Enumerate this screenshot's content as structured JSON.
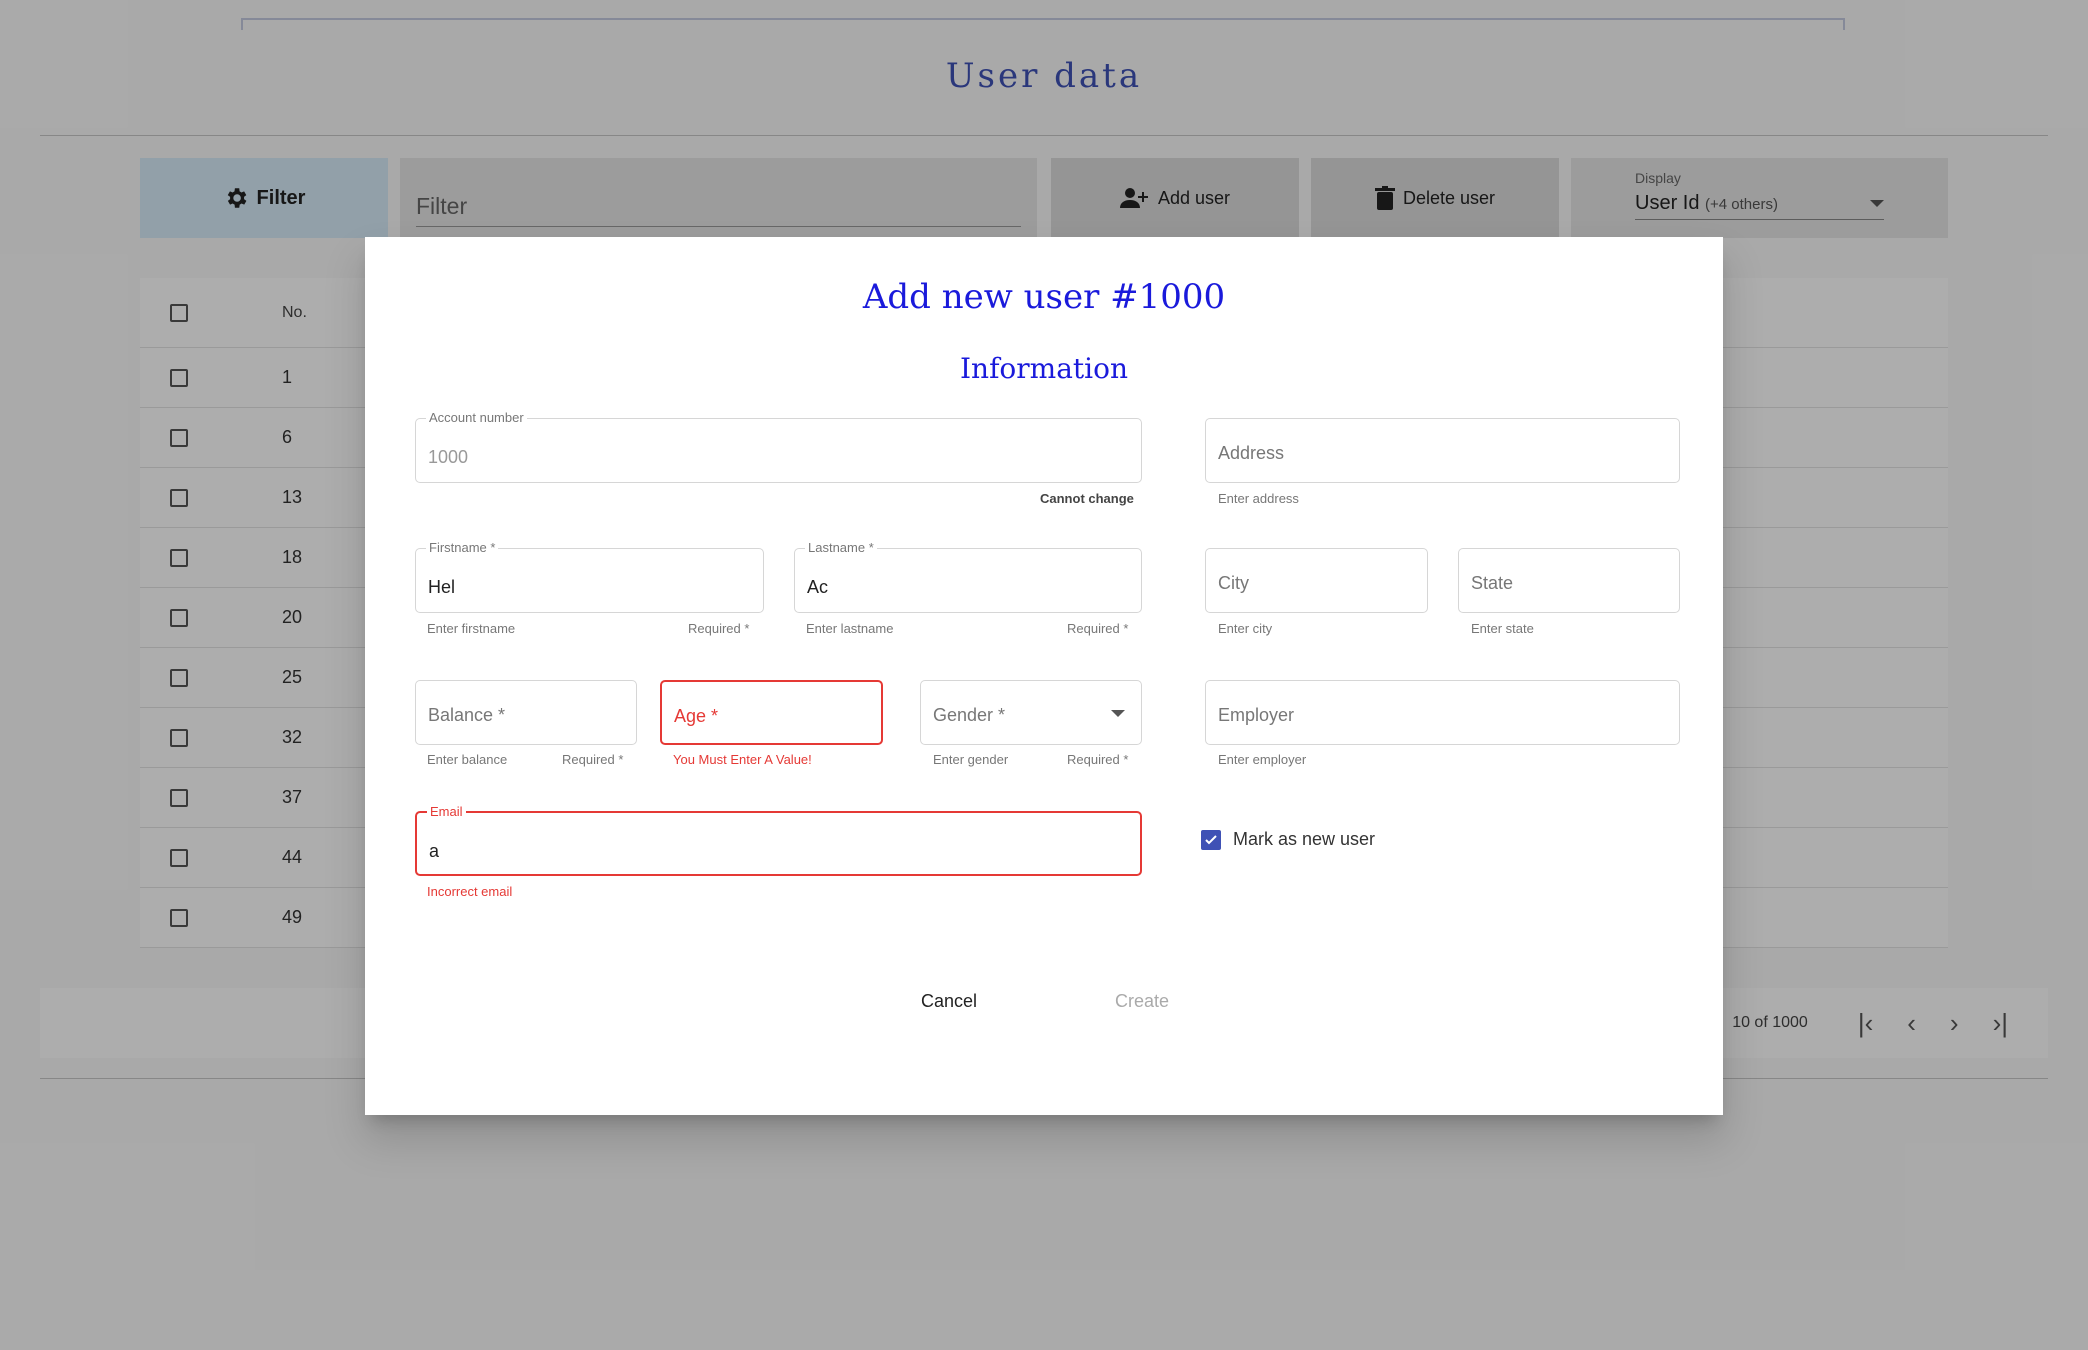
{
  "page": {
    "title": "User data"
  },
  "toolbar": {
    "filter_label": "Filter",
    "filter_placeholder": "Filter",
    "add_label": "Add user",
    "delete_label": "Delete user",
    "display_label": "Display",
    "display_value": "User Id",
    "display_extra": "(+4 others)"
  },
  "table": {
    "header_no": "No.",
    "rows": [
      "1",
      "6",
      "13",
      "18",
      "20",
      "25",
      "32",
      "37",
      "44",
      "49"
    ]
  },
  "pager": {
    "range": "10 of 1000"
  },
  "dialog": {
    "title": "Add new user #1000",
    "section": "Information",
    "account": {
      "label": "Account number",
      "value": "1000",
      "hint": "Cannot change"
    },
    "firstname": {
      "label": "Firstname *",
      "value": "Hel",
      "hint": "Enter firstname",
      "req": "Required *"
    },
    "lastname": {
      "label": "Lastname *",
      "value": "Ac",
      "hint": "Enter lastname",
      "req": "Required *"
    },
    "balance": {
      "placeholder": "Balance *",
      "hint": "Enter balance",
      "req": "Required *"
    },
    "age": {
      "placeholder": "Age *",
      "error": "You Must Enter A Value!"
    },
    "gender": {
      "placeholder": "Gender *",
      "hint": "Enter gender",
      "req": "Required *"
    },
    "email": {
      "label": "Email",
      "value": "a",
      "error": "Incorrect email"
    },
    "address": {
      "placeholder": "Address",
      "hint": "Enter address"
    },
    "city": {
      "placeholder": "City",
      "hint": "Enter city"
    },
    "state": {
      "placeholder": "State",
      "hint": "Enter state"
    },
    "employer": {
      "placeholder": "Employer",
      "hint": "Enter employer"
    },
    "new_user_label": "Mark as new user",
    "cancel_label": "Cancel",
    "create_label": "Create"
  },
  "colors": {
    "accent": "#3f51b5",
    "title": "#1a1adb",
    "error": "#e53935"
  }
}
